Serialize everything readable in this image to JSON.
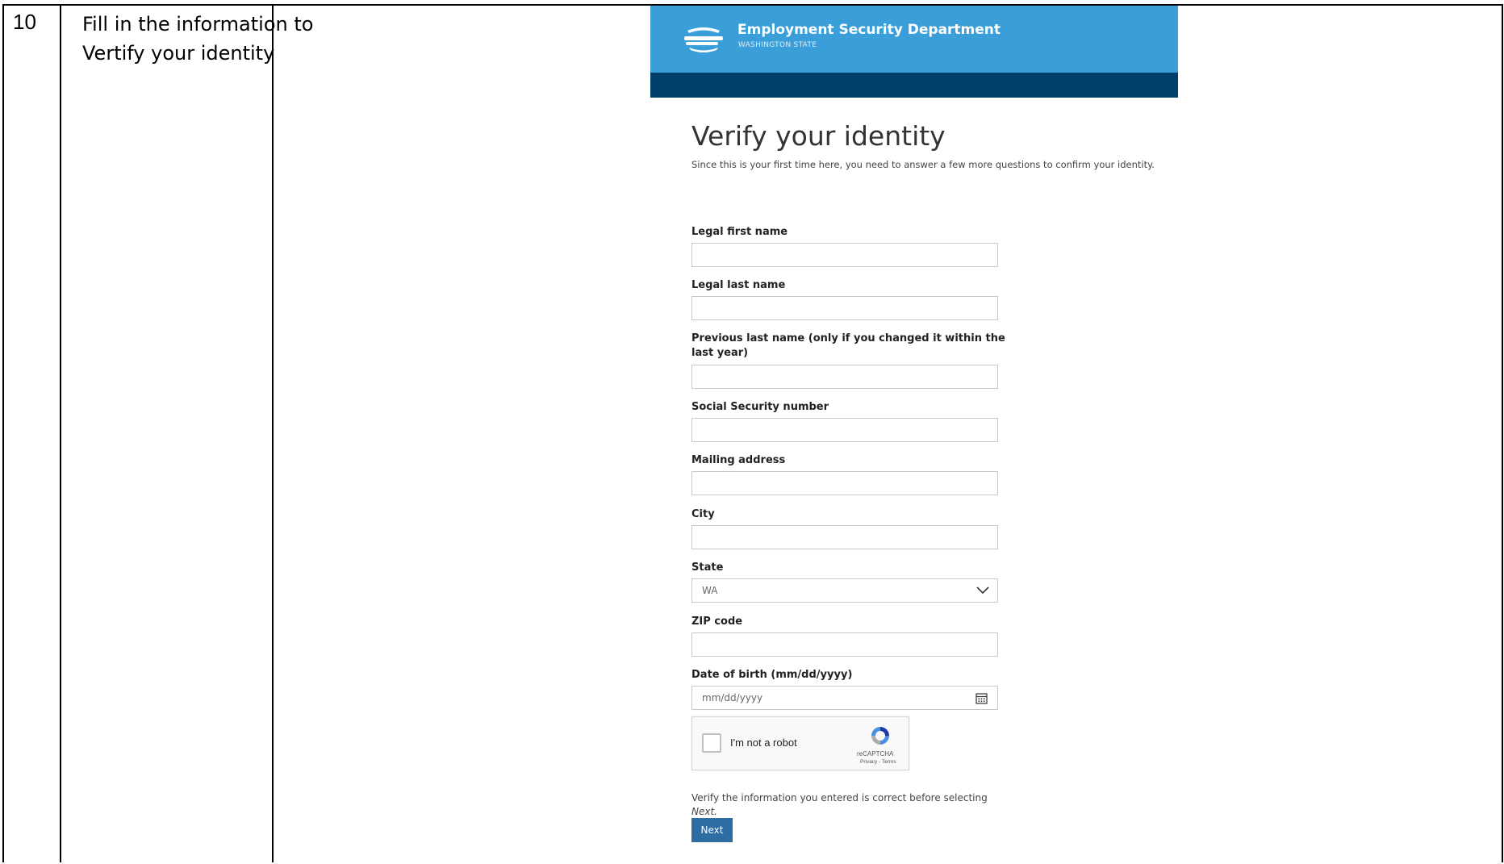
{
  "step": {
    "number": "10",
    "instruction": "Fill in the information to Vertify your identity"
  },
  "header": {
    "org_name": "Employment Security Department",
    "org_sub": "WASHINGTON STATE",
    "brand_color": "#3a9fd8",
    "band_color": "#003f6a",
    "logo_icon": "esd-logo-icon"
  },
  "page": {
    "title": "Verify your identity",
    "subtitle": "Since this is your first time here, you need to answer a few more questions to confirm your identity."
  },
  "fields": {
    "first_name": {
      "label": "Legal first name",
      "value": ""
    },
    "last_name": {
      "label": "Legal last name",
      "value": ""
    },
    "previous_last_name": {
      "label": "Previous last name (only if you changed it within the last year)",
      "value": ""
    },
    "ssn": {
      "label": "Social Security number",
      "value": ""
    },
    "mailing_address": {
      "label": "Mailing address",
      "value": ""
    },
    "city": {
      "label": "City",
      "value": ""
    },
    "state": {
      "label": "State",
      "value": "WA"
    },
    "zip": {
      "label": "ZIP code",
      "value": ""
    },
    "dob": {
      "label": "Date of birth (mm/dd/yyyy)",
      "placeholder": "mm/dd/yyyy"
    }
  },
  "captcha": {
    "label": "I'm not a robot",
    "brand": "reCAPTCHA",
    "links": "Privacy - Terms"
  },
  "footer": {
    "note_prefix": "Verify the information you entered is correct before selecting",
    "note_emph": "Next.",
    "next_label": "Next",
    "button_color": "#2e6da4"
  }
}
